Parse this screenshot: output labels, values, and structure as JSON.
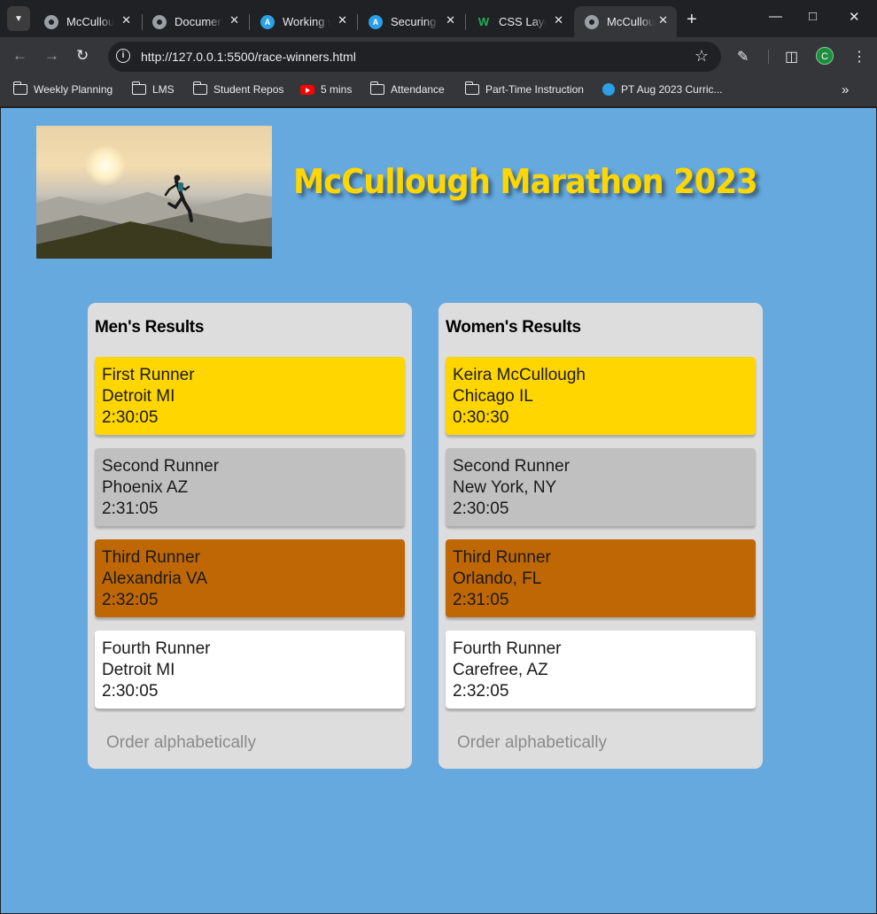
{
  "browser": {
    "tabs": [
      {
        "title": "McCullough",
        "icon": "globe-icon"
      },
      {
        "title": "Document",
        "icon": "globe-icon"
      },
      {
        "title": "Working with",
        "icon": "a-icon"
      },
      {
        "title": "Securing",
        "icon": "a-icon"
      },
      {
        "title": "CSS Layout",
        "icon": "w-icon"
      },
      {
        "title": "McCullough",
        "icon": "globe-icon",
        "active": true
      }
    ],
    "url": "http://127.0.0.1:5500/race-winners.html",
    "profile_initial": "C",
    "bookmarks": [
      {
        "label": "Weekly Planning",
        "icon": "folder-icon"
      },
      {
        "label": "LMS",
        "icon": "folder-icon"
      },
      {
        "label": "Student Repos",
        "icon": "folder-icon"
      },
      {
        "label": "5 mins",
        "icon": "youtube-icon"
      },
      {
        "label": "Attendance",
        "icon": "folder-icon"
      },
      {
        "label": "Part-Time Instruction",
        "icon": "folder-icon"
      },
      {
        "label": "PT  Aug 2023 Curric...",
        "icon": "a-icon"
      }
    ]
  },
  "page": {
    "title": "McCullough Marathon 2023",
    "title_color": "#ffd600",
    "background": "#66a9df",
    "men": {
      "heading": "Men's Results",
      "runners": [
        {
          "name": "First Runner",
          "city": "Detroit MI",
          "time": "2:30:05",
          "medal": "gold"
        },
        {
          "name": "Second Runner",
          "city": "Phoenix AZ",
          "time": "2:31:05",
          "medal": "silver"
        },
        {
          "name": "Third Runner",
          "city": "Alexandria VA",
          "time": "2:32:05",
          "medal": "bronze"
        },
        {
          "name": "Fourth Runner",
          "city": "Detroit MI",
          "time": "2:30:05",
          "medal": "none"
        }
      ],
      "order_button": "Order alphabetically"
    },
    "women": {
      "heading": "Women's Results",
      "runners": [
        {
          "name": "Keira McCullough",
          "city": "Chicago IL",
          "time": "0:30:30",
          "medal": "gold"
        },
        {
          "name": "Second Runner",
          "city": "New York, NY",
          "time": "2:30:05",
          "medal": "silver"
        },
        {
          "name": "Third Runner",
          "city": "Orlando, FL",
          "time": "2:31:05",
          "medal": "bronze"
        },
        {
          "name": "Fourth Runner",
          "city": "Carefree, AZ",
          "time": "2:32:05",
          "medal": "none"
        }
      ],
      "order_button": "Order alphabetically"
    },
    "medal_colors": {
      "gold": "#ffd600",
      "silver": "#c0c0c0",
      "bronze": "#bf6704",
      "none": "#ffffff"
    }
  }
}
